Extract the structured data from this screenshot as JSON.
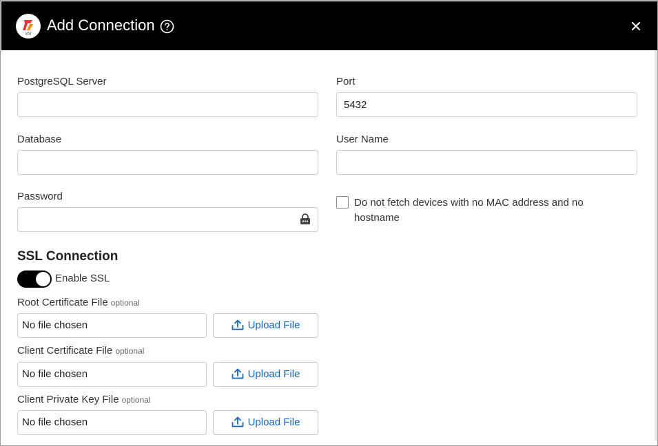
{
  "dialog": {
    "title": "Add Connection",
    "logo_text": "WII",
    "icons": {
      "logo": "brand-logo",
      "help": "help-circle-icon",
      "close": "close-icon",
      "lock": "lock-icon",
      "upload": "upload-icon"
    }
  },
  "form": {
    "server_label": "PostgreSQL Server",
    "server_value": "",
    "port_label": "Port",
    "port_value": "5432",
    "database_label": "Database",
    "database_value": "",
    "username_label": "User Name",
    "username_value": "",
    "password_label": "Password",
    "password_value": "",
    "no_mac_checkbox_label": "Do not fetch devices with no MAC address and no hostname",
    "no_mac_checked": false
  },
  "ssl": {
    "section_title": "SSL Connection",
    "enable_label": "Enable SSL",
    "enabled": true,
    "optional_text": "optional",
    "no_file_text": "No file chosen",
    "upload_label": "Upload File",
    "files": [
      {
        "label": "Root Certificate File"
      },
      {
        "label": "Client Certificate File"
      },
      {
        "label": "Client Private Key File"
      }
    ]
  },
  "colors": {
    "header_bg": "#000000",
    "accent": "#1565c0",
    "logo_red": "#e53935",
    "logo_orange": "#fb8c00"
  }
}
